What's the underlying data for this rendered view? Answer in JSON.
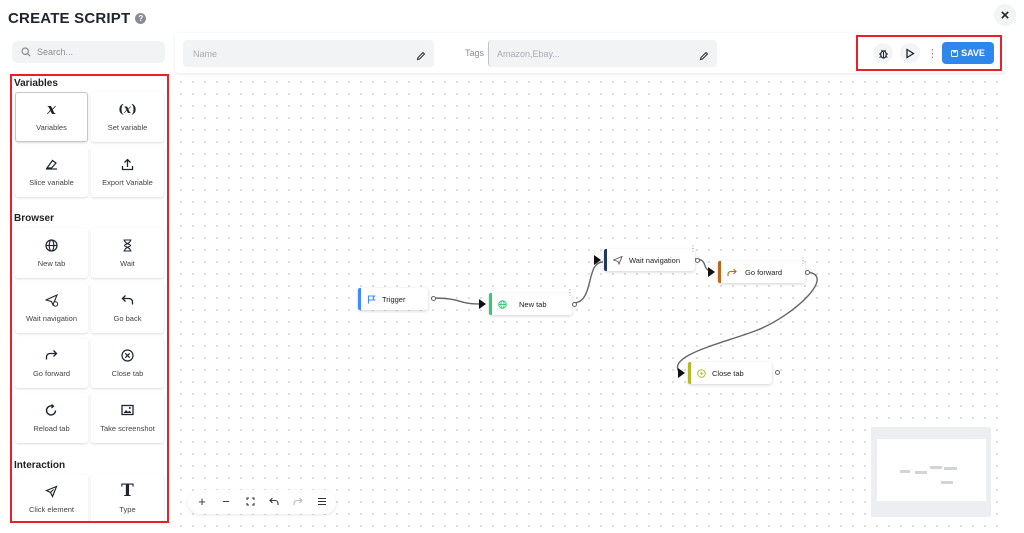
{
  "app": {
    "title": "CREATE SCRIPT",
    "help_icon": "help-circle-icon",
    "close_icon": "close-icon"
  },
  "sidebar": {
    "search_placeholder": "Search...",
    "sections": [
      {
        "title": "Variables",
        "items": [
          {
            "label": "Variables",
            "icon": "variable-x-icon",
            "active": true
          },
          {
            "label": "Set variable",
            "icon": "set-variable-icon"
          },
          {
            "label": "Slice variable",
            "icon": "eraser-icon"
          },
          {
            "label": "Export Variable",
            "icon": "export-icon"
          }
        ]
      },
      {
        "title": "Browser",
        "items": [
          {
            "label": "New tab",
            "icon": "globe-icon"
          },
          {
            "label": "Wait",
            "icon": "hourglass-icon"
          },
          {
            "label": "Wait navigation",
            "icon": "navigation-icon"
          },
          {
            "label": "Go back",
            "icon": "go-back-icon"
          },
          {
            "label": "Go forward",
            "icon": "go-forward-icon"
          },
          {
            "label": "Close tab",
            "icon": "close-circle-icon"
          },
          {
            "label": "Reload tab",
            "icon": "reload-icon"
          },
          {
            "label": "Take screenshot",
            "icon": "screenshot-icon"
          }
        ]
      },
      {
        "title": "Interaction",
        "items": [
          {
            "label": "Click element",
            "icon": "cursor-click-icon"
          },
          {
            "label": "Type",
            "icon": "type-icon"
          }
        ]
      }
    ]
  },
  "toolbar": {
    "name_placeholder": "Name",
    "tags_label": "Tags",
    "tags_placeholder": "Amazon,Ebay...",
    "save_label": "SAVE",
    "debug_icon": "bug-icon",
    "run_icon": "play-icon",
    "more_icon": "kebab-icon"
  },
  "canvas": {
    "nodes": [
      {
        "id": "trigger",
        "label": "Trigger",
        "color": "#3d8bfd",
        "icon": "flag-icon"
      },
      {
        "id": "newtab",
        "label": "New tab",
        "color": "#2ecc71",
        "icon": "globe-icon"
      },
      {
        "id": "waitnav",
        "label": "Wait navigation",
        "color": "#1e3a5f",
        "icon": "navigation-icon"
      },
      {
        "id": "goforward",
        "label": "Go forward",
        "color": "#c0651d",
        "icon": "go-forward-icon"
      },
      {
        "id": "closetab",
        "label": "Close tab",
        "color": "#b5b82a",
        "icon": "close-circle-icon"
      }
    ]
  },
  "controls": [
    "zoom-in-icon",
    "zoom-out-icon",
    "fit-view-icon",
    "undo-icon",
    "redo-icon",
    "menu-icon"
  ]
}
